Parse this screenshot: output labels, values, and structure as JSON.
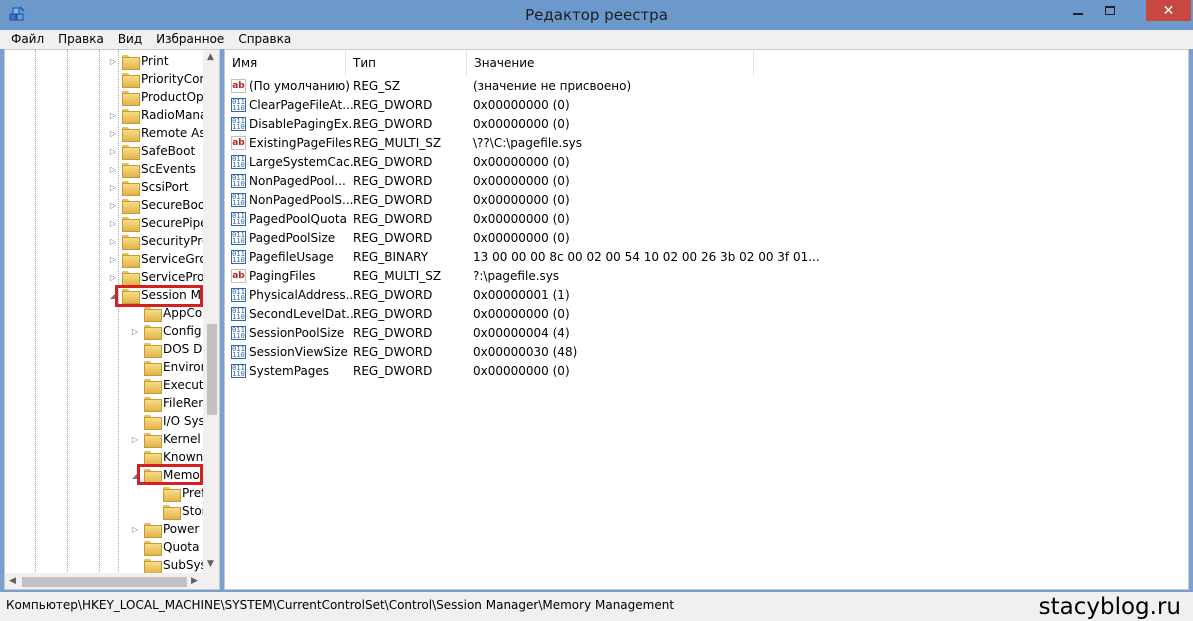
{
  "window": {
    "title": "Редактор реестра"
  },
  "menu": [
    "Файл",
    "Правка",
    "Вид",
    "Избранное",
    "Справка"
  ],
  "tree": {
    "items": [
      {
        "label": "Print",
        "expander": "▷"
      },
      {
        "label": "PriorityCor",
        "expander": ""
      },
      {
        "label": "ProductOp",
        "expander": ""
      },
      {
        "label": "RadioMana",
        "expander": "▷"
      },
      {
        "label": "Remote As",
        "expander": "▷"
      },
      {
        "label": "SafeBoot",
        "expander": "▷"
      },
      {
        "label": "ScEvents",
        "expander": "▷"
      },
      {
        "label": "ScsiPort",
        "expander": "▷"
      },
      {
        "label": "SecureBoo",
        "expander": "▷"
      },
      {
        "label": "SecurePipe",
        "expander": "▷"
      },
      {
        "label": "SecurityPro",
        "expander": "▷"
      },
      {
        "label": "ServiceGro",
        "expander": "▷"
      },
      {
        "label": "ServiceProv",
        "expander": "▷"
      },
      {
        "label": "Session Ma",
        "expander": "◢"
      },
      {
        "label": "AppCo",
        "expander": ""
      },
      {
        "label": "Config",
        "expander": "▷"
      },
      {
        "label": "DOS De",
        "expander": ""
      },
      {
        "label": "Enviror",
        "expander": ""
      },
      {
        "label": "Executi",
        "expander": ""
      },
      {
        "label": "FileRen",
        "expander": ""
      },
      {
        "label": "I/O Sys",
        "expander": ""
      },
      {
        "label": "Kernel",
        "expander": "▷"
      },
      {
        "label": "Known",
        "expander": ""
      },
      {
        "label": "Memo",
        "expander": "◢"
      },
      {
        "label": "Pref",
        "expander": ""
      },
      {
        "label": "Stor",
        "expander": ""
      },
      {
        "label": "Power",
        "expander": "▷"
      },
      {
        "label": "Quota S",
        "expander": ""
      },
      {
        "label": "SubSys",
        "expander": ""
      }
    ]
  },
  "list": {
    "columns": [
      "Имя",
      "Тип",
      "Значение"
    ],
    "rows": [
      {
        "icon": "string-value-icon",
        "name": "(По умолчанию)",
        "type": "REG_SZ",
        "value": "(значение не присвоено)"
      },
      {
        "icon": "binary-value-icon",
        "name": "ClearPageFileAt...",
        "type": "REG_DWORD",
        "value": "0x00000000 (0)"
      },
      {
        "icon": "binary-value-icon",
        "name": "DisablePagingEx...",
        "type": "REG_DWORD",
        "value": "0x00000000 (0)"
      },
      {
        "icon": "string-value-icon",
        "name": "ExistingPageFiles",
        "type": "REG_MULTI_SZ",
        "value": "\\??\\C:\\pagefile.sys"
      },
      {
        "icon": "binary-value-icon",
        "name": "LargeSystemCac...",
        "type": "REG_DWORD",
        "value": "0x00000000 (0)"
      },
      {
        "icon": "binary-value-icon",
        "name": "NonPagedPool...",
        "type": "REG_DWORD",
        "value": "0x00000000 (0)"
      },
      {
        "icon": "binary-value-icon",
        "name": "NonPagedPoolS...",
        "type": "REG_DWORD",
        "value": "0x00000000 (0)"
      },
      {
        "icon": "binary-value-icon",
        "name": "PagedPoolQuota",
        "type": "REG_DWORD",
        "value": "0x00000000 (0)"
      },
      {
        "icon": "binary-value-icon",
        "name": "PagedPoolSize",
        "type": "REG_DWORD",
        "value": "0x00000000 (0)"
      },
      {
        "icon": "binary-value-icon",
        "name": "PagefileUsage",
        "type": "REG_BINARY",
        "value": "13 00 00 00 8c 00 02 00 54 10 02 00 26 3b 02 00 3f 01..."
      },
      {
        "icon": "string-value-icon",
        "name": "PagingFiles",
        "type": "REG_MULTI_SZ",
        "value": "?:\\pagefile.sys"
      },
      {
        "icon": "binary-value-icon",
        "name": "PhysicalAddress...",
        "type": "REG_DWORD",
        "value": "0x00000001 (1)"
      },
      {
        "icon": "binary-value-icon",
        "name": "SecondLevelDat...",
        "type": "REG_DWORD",
        "value": "0x00000000 (0)"
      },
      {
        "icon": "binary-value-icon",
        "name": "SessionPoolSize",
        "type": "REG_DWORD",
        "value": "0x00000004 (4)"
      },
      {
        "icon": "binary-value-icon",
        "name": "SessionViewSize",
        "type": "REG_DWORD",
        "value": "0x00000030 (48)"
      },
      {
        "icon": "binary-value-icon",
        "name": "SystemPages",
        "type": "REG_DWORD",
        "value": "0x00000000 (0)"
      }
    ]
  },
  "statusbar": {
    "path": "Компьютер\\HKEY_LOCAL_MACHINE\\SYSTEM\\CurrentControlSet\\Control\\Session Manager\\Memory Management",
    "watermark": "stacyblog.ru"
  },
  "colors": {
    "titlebar": "#6d98cc",
    "close": "#c7483e",
    "highlight": "#d32020"
  }
}
